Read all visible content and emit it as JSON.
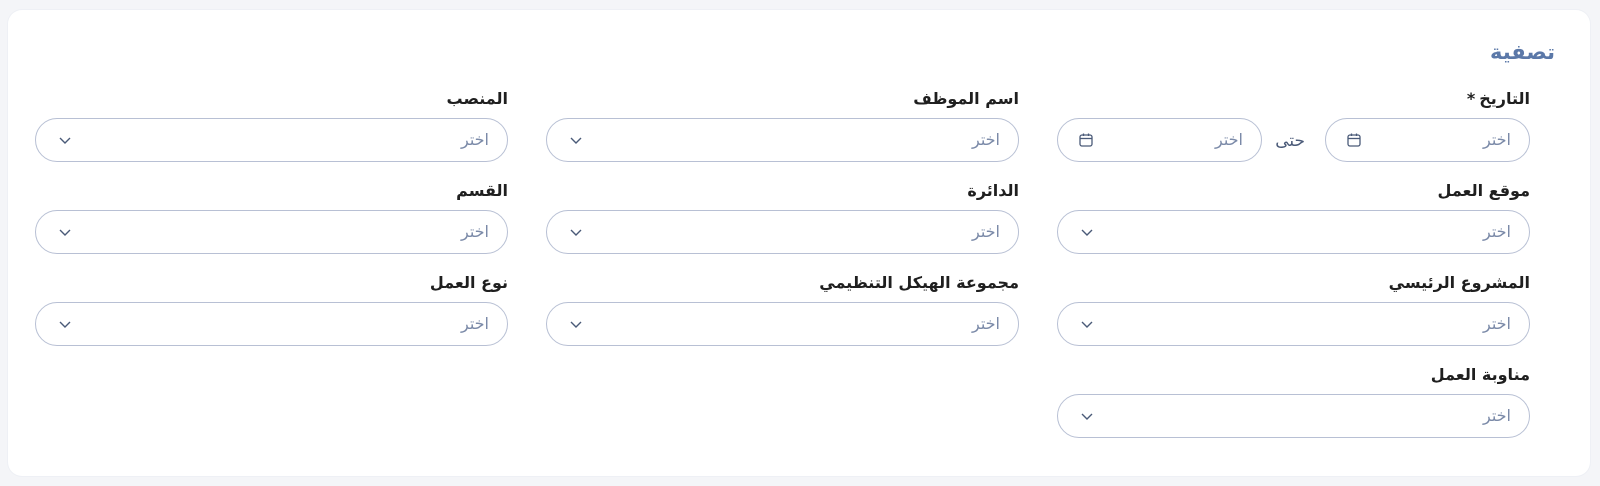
{
  "filter_title": "تصفية",
  "placeholder": "اختر",
  "date": {
    "label": "التاريخ",
    "required_mark": "*",
    "from_value": "اختر",
    "to_value": "اختر",
    "separator": "حتى"
  },
  "fields": {
    "employee_name": {
      "label": "اسم الموظف",
      "value": "اختر"
    },
    "position": {
      "label": "المنصب",
      "value": "اختر"
    },
    "work_location": {
      "label": "موقع العمل",
      "value": "اختر"
    },
    "department": {
      "label": "الدائرة",
      "value": "اختر"
    },
    "section": {
      "label": "القسم",
      "value": "اختر"
    },
    "main_project": {
      "label": "المشروع الرئيسي",
      "value": "اختر"
    },
    "org_structure_group": {
      "label": "مجموعة الهيكل التنظيمي",
      "value": "اختر"
    },
    "work_type": {
      "label": "نوع العمل",
      "value": "اختر"
    },
    "work_shift": {
      "label": "مناوبة العمل",
      "value": "اختر"
    }
  },
  "icons": {
    "calendar": "calendar-icon",
    "dropdown": "chevron-down-icon"
  },
  "colors": {
    "title": "#5b78a8",
    "border": "#b8c0d4",
    "placeholder": "#7b8aa8"
  }
}
